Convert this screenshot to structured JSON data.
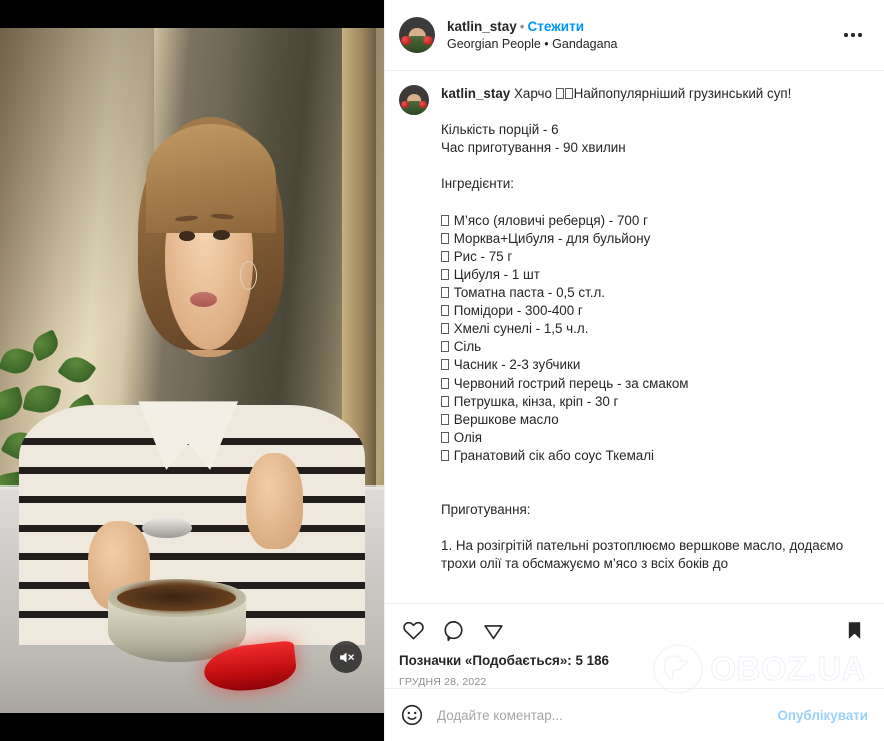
{
  "post_header": {
    "username": "katlin_stay",
    "separator": "•",
    "follow_label": "Стежити",
    "audio_line": "Georgian People • Gandagana",
    "more_icon": "more-options-icon"
  },
  "media": {
    "mute_icon": "muted-speaker-icon",
    "type": "video"
  },
  "caption": {
    "username": "katlin_stay",
    "line_title": "Харчо ",
    "text": "Найпопулярніший грузинський суп!\n\nКількість порцій - 6\nЧас приготування - 90 хвилин\n\nІнгредієнти:\n\n",
    "ingredients": [
      "М’ясо (яловичі реберця) - 700 г",
      "Морква+Цибуля - для бульйону",
      "Рис - 75 г",
      "Цибуля - 1 шт",
      "Томатна паста - 0,5 ст.л.",
      "Помідори - 300-400 г",
      "Хмелі сунелі - 1,5 ч.л.",
      "Сіль",
      "Часник - 2-3 зубчики",
      "Червоний гострий перець - за смаком",
      "Петрушка, кінза, кріп - 30 г",
      "Вершкове масло",
      "Олія",
      "Гранатовий сік або соус Ткемалі"
    ],
    "prep_heading": "Приготування:",
    "prep_step": "1. На розігрітій пательні розтоплюємо вершкове масло, додаємо трохи олії та обсмажуємо м’ясо з всіх боків до"
  },
  "actions": {
    "like_icon": "heart-icon",
    "comment_icon": "comment-bubble-icon",
    "share_icon": "share-paper-plane-icon",
    "save_icon": "bookmark-filled-icon",
    "likes_label": "Позначки «Подобається»: 5 186",
    "likes_count": "5 186",
    "date": "ГРУДНЯ 28, 2022"
  },
  "comment_bar": {
    "emoji_icon": "emoji-smiley-icon",
    "placeholder": "Додайте коментар...",
    "post_label": "Опублікувати"
  },
  "watermark": {
    "text": "OBOZ.UA",
    "logo_icon": "globe-icon"
  },
  "colors": {
    "link_blue": "#0095f6",
    "post_blue": "#9bd0fb",
    "text_primary": "#262626",
    "text_muted": "#8e8e8e",
    "border": "#efefef"
  }
}
